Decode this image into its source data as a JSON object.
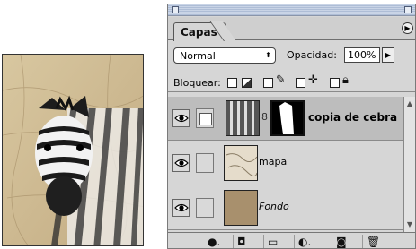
{
  "panel": {
    "tab_label": "Capas",
    "blend_mode": "Normal",
    "opacity_label": "Opacidad:",
    "opacity_value": "100%",
    "lock_label": "Bloquear:"
  },
  "layers": [
    {
      "name": "copia de cebra",
      "selected": true,
      "visible": true,
      "has_mask": true
    },
    {
      "name": "mapa",
      "selected": false,
      "visible": true,
      "has_mask": false
    },
    {
      "name": "Fondo",
      "selected": false,
      "visible": true,
      "has_mask": false
    }
  ],
  "colors": {
    "panel_bg": "#d6d6d6",
    "selected_row": "#bdbdbd",
    "fondo_fill": "#a8906d",
    "map_tone": "#c9b48c"
  },
  "icons": {
    "bottom_toolbar": [
      "layer-style-icon",
      "add-mask-icon",
      "new-set-icon",
      "adjustment-layer-icon",
      "new-layer-icon",
      "trash-icon"
    ]
  }
}
